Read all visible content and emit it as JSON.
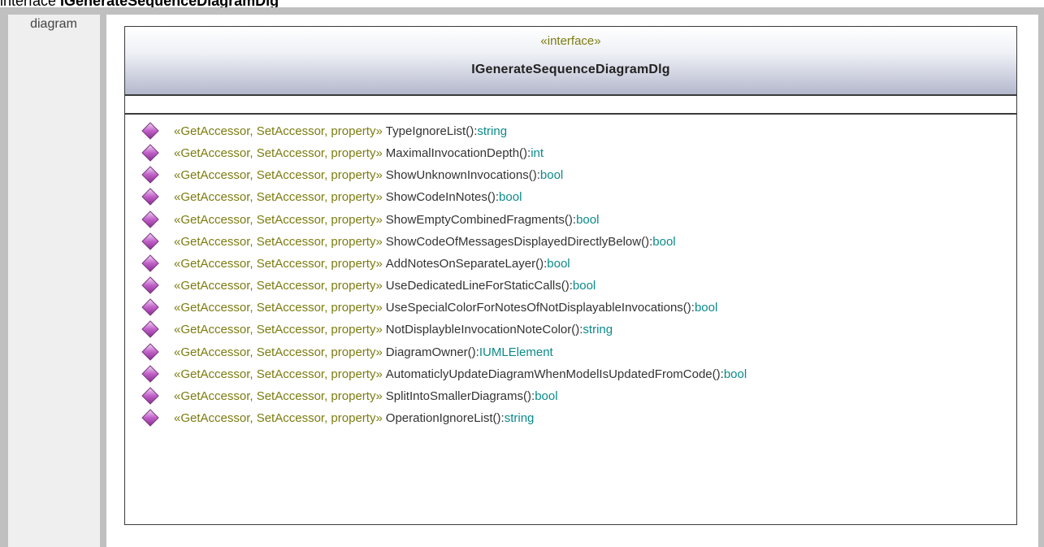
{
  "page": {
    "heading_prefix": "interface ",
    "heading_name": "IGenerateSequenceDiagramDlg",
    "section_label": "diagram"
  },
  "uml": {
    "stereotype": "«interface»",
    "class_name": "IGenerateSequenceDiagramDlg",
    "operations": [
      {
        "stereotype": "«GetAccessor, SetAccessor, property»",
        "name": "TypeIgnoreList",
        "sep": "():",
        "type": "string"
      },
      {
        "stereotype": "«GetAccessor, SetAccessor, property»",
        "name": "MaximalInvocationDepth",
        "sep": "():",
        "type": "int"
      },
      {
        "stereotype": "«GetAccessor, SetAccessor, property»",
        "name": "ShowUnknownInvocations",
        "sep": "():",
        "type": "bool"
      },
      {
        "stereotype": "«GetAccessor, SetAccessor, property»",
        "name": "ShowCodeInNotes",
        "sep": "():",
        "type": "bool"
      },
      {
        "stereotype": "«GetAccessor, SetAccessor, property»",
        "name": "ShowEmptyCombinedFragments",
        "sep": "():",
        "type": "bool"
      },
      {
        "stereotype": "«GetAccessor, SetAccessor, property»",
        "name": "ShowCodeOfMessagesDisplayedDirectlyBelow",
        "sep": "():",
        "type": "bool"
      },
      {
        "stereotype": "«GetAccessor, SetAccessor, property»",
        "name": "AddNotesOnSeparateLayer",
        "sep": "():",
        "type": "bool"
      },
      {
        "stereotype": "«GetAccessor, SetAccessor, property»",
        "name": "UseDedicatedLineForStaticCalls",
        "sep": "():",
        "type": "bool"
      },
      {
        "stereotype": "«GetAccessor, SetAccessor, property»",
        "name": "UseSpecialColorForNotesOfNotDisplayableInvocations",
        "sep": "():",
        "type": "bool"
      },
      {
        "stereotype": "«GetAccessor, SetAccessor, property»",
        "name": "NotDisplaybleInvocationNoteColor",
        "sep": "():",
        "type": "string"
      },
      {
        "stereotype": "«GetAccessor, SetAccessor, property»",
        "name": "DiagramOwner",
        "sep": "():",
        "type": "IUMLElement"
      },
      {
        "stereotype": "«GetAccessor, SetAccessor, property»",
        "name": "AutomaticlyUpdateDiagramWhenModelIsUpdatedFromCode",
        "sep": "():",
        "type": "bool"
      },
      {
        "stereotype": "«GetAccessor, SetAccessor, property»",
        "name": "SplitIntoSmallerDiagrams",
        "sep": "():",
        "type": "bool"
      },
      {
        "stereotype": "«GetAccessor, SetAccessor, property»",
        "name": "OperationIgnoreList",
        "sep": "():",
        "type": "string"
      }
    ]
  },
  "colors": {
    "stereotype": "#7c7c10",
    "type": "#0b8a8a",
    "operation_icon": "#c060c8"
  },
  "icons": {
    "operation": "public-operation-diamond-icon"
  }
}
